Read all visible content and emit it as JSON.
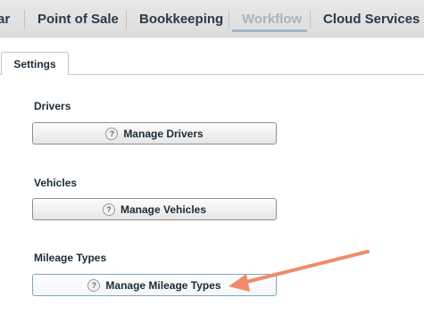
{
  "nav": {
    "items": [
      {
        "label": "ar"
      },
      {
        "label": "Point of Sale"
      },
      {
        "label": "Bookkeeping"
      },
      {
        "label": "Workflow"
      },
      {
        "label": "Cloud Services"
      }
    ],
    "active": "Workflow"
  },
  "tabs": [
    {
      "label": "Settings"
    }
  ],
  "sections": [
    {
      "label": "Drivers",
      "button": "Manage Drivers"
    },
    {
      "label": "Vehicles",
      "button": "Manage Vehicles"
    },
    {
      "label": "Mileage Types",
      "button": "Manage Mileage Types"
    }
  ],
  "help_glyph": "?",
  "colors": {
    "arrow": "#f08a6a",
    "active_nav_text": "#aab4bd",
    "active_nav_underline": "#9fb4c8",
    "focused_button_border": "#7fa7b8"
  },
  "icons": [
    "help-icon",
    "arrow-annotation"
  ]
}
